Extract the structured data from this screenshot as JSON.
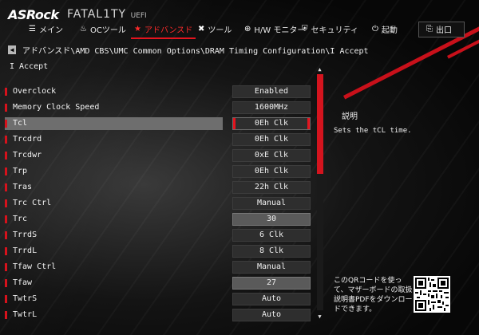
{
  "header": {
    "brand": "ASRock",
    "series": "FATAL1TY",
    "firmware": "UEFI",
    "nav": [
      {
        "label": "メイン",
        "icon": "menu-icon"
      },
      {
        "label": "OCツール",
        "icon": "flame-icon"
      },
      {
        "label": "アドバンスド",
        "icon": "star-icon"
      },
      {
        "label": "ツール",
        "icon": "tools-icon"
      },
      {
        "label": "H/W モニター",
        "icon": "monitor-icon"
      },
      {
        "label": "セキュリティ",
        "icon": "shield-icon"
      },
      {
        "label": "起動",
        "icon": "power-icon"
      },
      {
        "label": "出口",
        "icon": "exit-icon"
      }
    ],
    "active_tab": "アドバンスド",
    "accent_color": "#e4141e"
  },
  "breadcrumb": "アドバンスド\\AMD CBS\\UMC Common Options\\DRAM Timing Configuration\\I Accept",
  "page_subtitle": "I Accept",
  "settings": [
    {
      "name": "Overclock",
      "value": "Enabled"
    },
    {
      "name": "Memory Clock Speed",
      "value": "1600MHz"
    },
    {
      "name": "Tcl",
      "value": "0Eh Clk",
      "selected": true
    },
    {
      "name": "Trcdrd",
      "value": "0Eh Clk"
    },
    {
      "name": "Trcdwr",
      "value": "0xE Clk"
    },
    {
      "name": "Trp",
      "value": "0Eh Clk"
    },
    {
      "name": "Tras",
      "value": "22h Clk"
    },
    {
      "name": "Trc Ctrl",
      "value": "Manual"
    },
    {
      "name": "Trc",
      "value": "30",
      "readonly": true
    },
    {
      "name": "TrrdS",
      "value": "6 Clk"
    },
    {
      "name": "TrrdL",
      "value": "8 Clk"
    },
    {
      "name": "Tfaw Ctrl",
      "value": "Manual"
    },
    {
      "name": "Tfaw",
      "value": "27",
      "readonly": true
    },
    {
      "name": "TwtrS",
      "value": "Auto"
    },
    {
      "name": "TwtrL",
      "value": "Auto"
    }
  ],
  "help": {
    "title": "説明",
    "text": "Sets the tCL time.",
    "qr_text": "このQRコードを使って、マザーボードの取扱説明書PDFをダウンロードできます。"
  }
}
